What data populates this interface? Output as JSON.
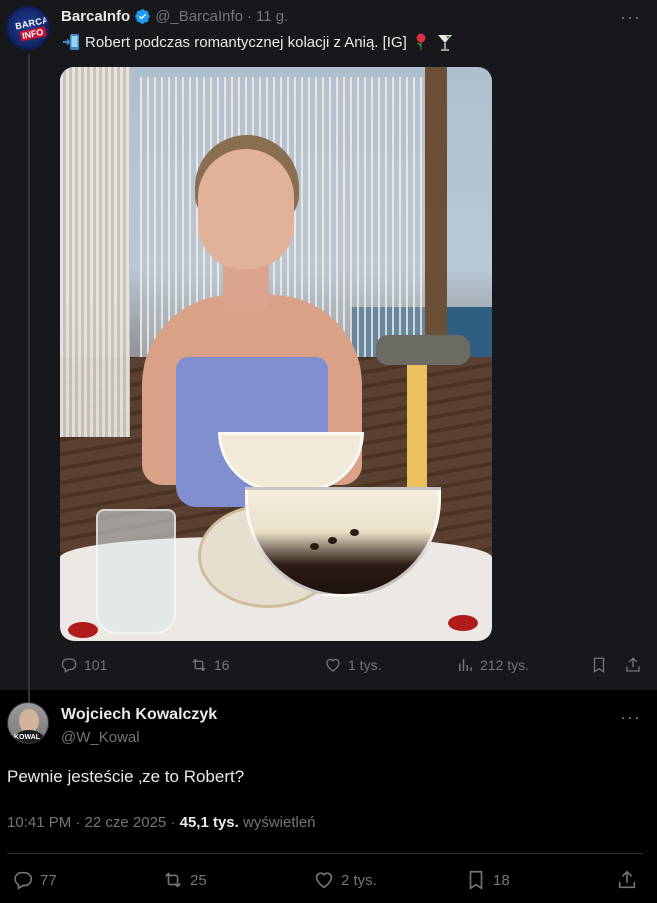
{
  "quoted_tweet": {
    "author": {
      "name": "BarcaInfo",
      "handle": "@_BarcaInfo",
      "separator": "·",
      "time": "11 g.",
      "avatar_text_1": "BARCA",
      "avatar_text_2": "INFO",
      "verified_color": "#1d9bf0"
    },
    "text": "Robert podczas romantycznej kolacji z Anią. [IG]",
    "emojis": [
      "mobile-phone-arrow-icon",
      "rose-icon",
      "cocktail-glass-icon"
    ],
    "media_alt": "photo-woman-with-espresso-martini",
    "actions": {
      "replies": "101",
      "reposts": "16",
      "likes": "1 tys.",
      "views": "212 tys."
    },
    "more_label": "···"
  },
  "reply_tweet": {
    "author": {
      "name": "Wojciech Kowalczyk",
      "handle": "@W_Kowal",
      "avatar_text": "KOWAL"
    },
    "text": "Pewnie jesteście ‚ze to Robert?",
    "timestamp": "10:41 PM · 22 cze 2025 ·",
    "views_count": "45,1 tys.",
    "views_label": "wyświetleń",
    "actions": {
      "replies": "77",
      "reposts": "25",
      "likes": "2 tys.",
      "bookmarks": "18"
    },
    "more_label": "···"
  },
  "colors": {
    "background": "#000000",
    "quoted_background": "#16181c",
    "text_primary": "#e7e9ea",
    "text_secondary": "#71767b",
    "divider": "#2f3336",
    "accent": "#1d9bf0"
  }
}
